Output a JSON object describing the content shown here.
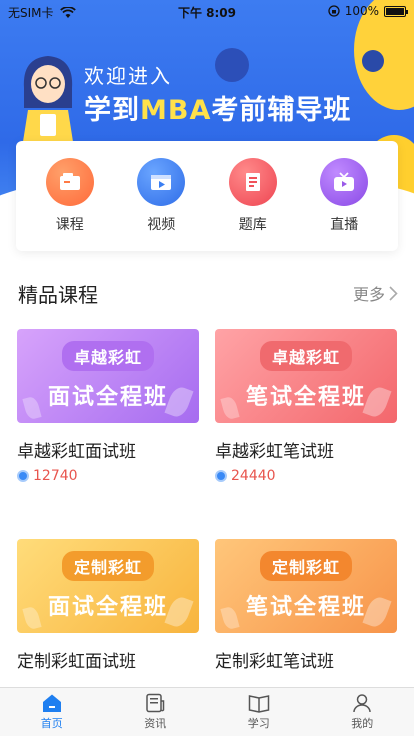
{
  "status_bar": {
    "carrier": "无SIM卡",
    "time": "下午 8:09",
    "battery": "100%"
  },
  "banner": {
    "line1": "欢迎进入",
    "line2_pre": "学到",
    "line2_highlight": "MBA",
    "line2_post": "考前辅导班"
  },
  "quick_menu": [
    {
      "label": "课程",
      "icon": "course-icon",
      "color": "#ff7a45"
    },
    {
      "label": "视频",
      "icon": "video-icon",
      "color": "#3b7ff2"
    },
    {
      "label": "题库",
      "icon": "question-bank-icon",
      "color": "#f0525a"
    },
    {
      "label": "直播",
      "icon": "live-icon",
      "color": "#9a5ae8"
    }
  ],
  "section": {
    "title": "精品课程",
    "more": "更多"
  },
  "courses": [
    {
      "tag": "卓越彩虹",
      "big": "面试全程班",
      "name": "卓越彩虹面试班",
      "count": "12740",
      "gradient": [
        "#c48cf6",
        "#a770ef"
      ],
      "tag_color": "#b06ff0"
    },
    {
      "tag": "卓越彩虹",
      "big": "笔试全程班",
      "name": "卓越彩虹笔试班",
      "count": "24440",
      "gradient": [
        "#ff9a9e",
        "#f4686c"
      ],
      "tag_color": "#f06a6e"
    },
    {
      "tag": "定制彩虹",
      "big": "面试全程班",
      "name": "定制彩虹面试班",
      "count": "",
      "gradient": [
        "#ffd36a",
        "#f8b640"
      ],
      "tag_color": "#f39c2c"
    },
    {
      "tag": "定制彩虹",
      "big": "笔试全程班",
      "name": "定制彩虹笔试班",
      "count": "",
      "gradient": [
        "#ffc06a",
        "#f7984a"
      ],
      "tag_color": "#f3872e"
    }
  ],
  "tab_bar": [
    {
      "label": "首页",
      "icon": "home-icon",
      "active": true
    },
    {
      "label": "资讯",
      "icon": "news-icon",
      "active": false
    },
    {
      "label": "学习",
      "icon": "study-book-icon",
      "active": false
    },
    {
      "label": "我的",
      "icon": "profile-icon",
      "active": false
    }
  ],
  "colors": {
    "accent": "#1f7ff0",
    "count": "#e8554e",
    "banner_bg": "#3d7cf1"
  }
}
